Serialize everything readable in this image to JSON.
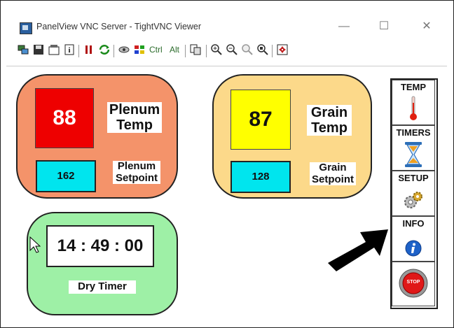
{
  "window": {
    "title": "PanelView VNC Server - TightVNC Viewer",
    "minimize_glyph": "—",
    "maximize_glyph": "☐",
    "close_glyph": "✕"
  },
  "toolbar": {
    "ctrl_label": "Ctrl",
    "alt_label": "Alt"
  },
  "plenum": {
    "value": "88",
    "label_line1": "Plenum",
    "label_line2": "Temp",
    "setpoint": "162",
    "setpoint_label_line1": "Plenum",
    "setpoint_label_line2": "Setpoint",
    "bg_color": "#f4936a",
    "value_color": "#ee0000"
  },
  "grain": {
    "value": "87",
    "label_line1": "Grain",
    "label_line2": "Temp",
    "setpoint": "128",
    "setpoint_label_line1": "Grain",
    "setpoint_label_line2": "Setpoint",
    "bg_color": "#fcd98a",
    "value_color": "#ffff00"
  },
  "timer": {
    "value": "14 : 49 : 00",
    "label": "Dry Timer",
    "bg_color": "#9ef0a6"
  },
  "nav": {
    "temp_label": "TEMP",
    "timers_label": "TIMERS",
    "setup_label": "SETUP",
    "info_label": "INFO",
    "stop_label": "STOP"
  }
}
